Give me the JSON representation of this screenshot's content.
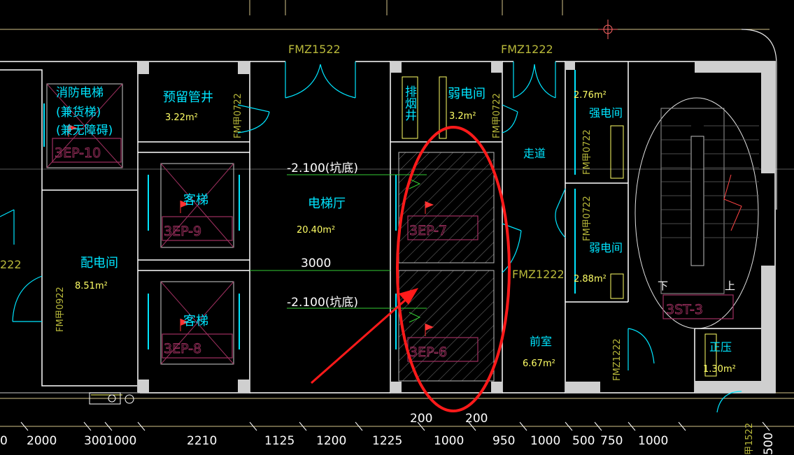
{
  "rooms": {
    "fire_elevator": {
      "name": "消防电梯",
      "line2": "(兼货梯)",
      "line3": "(兼无障碍)",
      "tag": "3EP-10"
    },
    "reserved_shaft": {
      "name": "预留管井",
      "area": "3.22m²"
    },
    "passenger_elevator_top": {
      "name": "客梯",
      "tag": "3EP-9"
    },
    "passenger_elevator_bottom": {
      "name": "客梯",
      "tag": "3EP-8"
    },
    "power_room": {
      "name": "配电间",
      "area": "8.51m²"
    },
    "elevator_hall": {
      "name": "电梯厅",
      "area": "20.40m²"
    },
    "smoke_shaft": {
      "name": "排烟井"
    },
    "weak_current_top": {
      "name": "弱电间",
      "area": "3.2m²"
    },
    "elevator_pit_top": {
      "tag": "3EP-7"
    },
    "elevator_pit_bottom": {
      "tag": "3EP-6"
    },
    "corridor": {
      "name": "走道"
    },
    "strong_current": {
      "name": "强电间",
      "area": "2.76m²"
    },
    "weak_current_bottom": {
      "name": "弱电间",
      "area": "2.88m²"
    },
    "anteroom": {
      "name": "前室",
      "area": "6.67m²"
    },
    "stair": {
      "tag": "3ST-3",
      "down": "下",
      "up": "上"
    },
    "pressurization": {
      "name": "正压",
      "area": "1.30m²"
    }
  },
  "doors": {
    "fmz1522": "FMZ1522",
    "fmz1222_top": "FMZ1222",
    "fmz1222_mid": "FMZ1222",
    "fmz1222_right": "FMZ1222",
    "fmj0722_a": "FM甲0722",
    "fmj0722_b": "FM甲0722",
    "fmj0722_c": "FM甲0722",
    "fmj0722_d": "FM甲0722",
    "fmj0722_e": "FM甲0722",
    "fmj0922": "FM甲0922",
    "left_cut": "222",
    "right_cut": "甲1522"
  },
  "annotations": {
    "pit_top": "-2.100(坑底)",
    "pit_bottom": "-2.100(坑底)",
    "hall_width": "3000",
    "gap_left": "200",
    "gap_right": "200"
  },
  "dimensions": [
    "0",
    "2000",
    "300",
    "1000",
    "2210",
    "1125",
    "1200",
    "1225",
    "1000",
    "950",
    "1000",
    "500",
    "750",
    "1000",
    "500"
  ],
  "colors": {
    "wall": "#ffffff",
    "door": "#00e5ff",
    "room_text": "#00e5ff",
    "area_text": "#ffff66",
    "door_label": "#b8b83a",
    "tag": "#a03060",
    "dimension": "#ffffff",
    "grid": "#d4c48a",
    "highlight": "#ff1a1a",
    "level_line": "#33cc33"
  }
}
